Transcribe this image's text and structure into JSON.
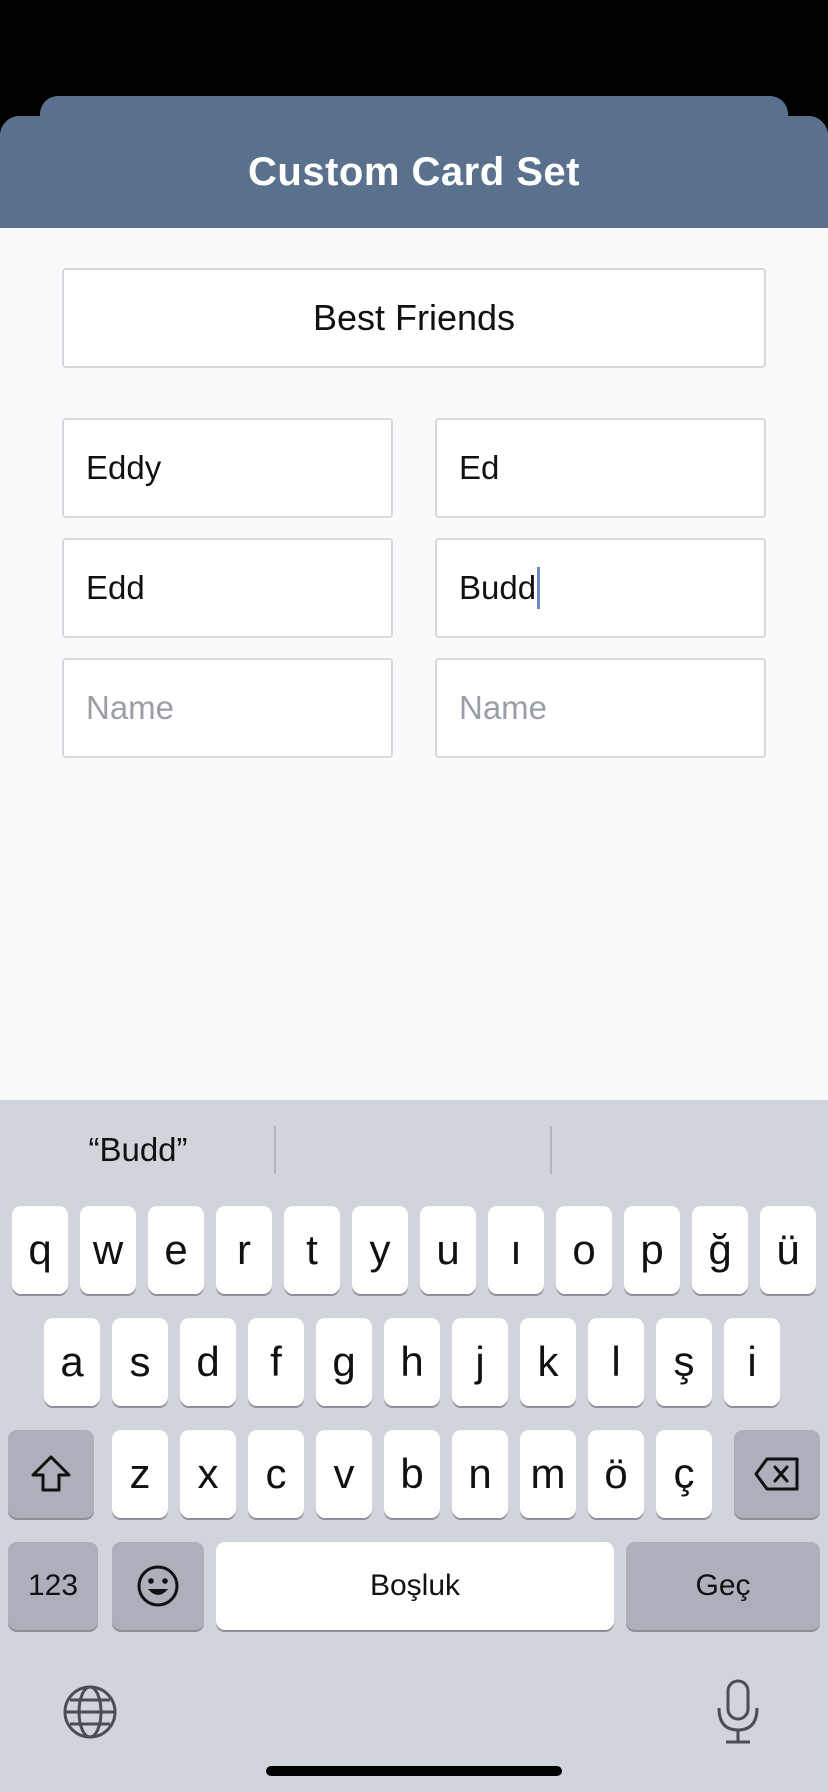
{
  "header": {
    "title": "Custom Card Set"
  },
  "form": {
    "set_name": "Best Friends",
    "names": [
      {
        "value": "Eddy",
        "placeholder": "Name"
      },
      {
        "value": "Ed",
        "placeholder": "Name"
      },
      {
        "value": "Edd",
        "placeholder": "Name"
      },
      {
        "value": "Budd",
        "placeholder": "Name"
      },
      {
        "value": "",
        "placeholder": "Name"
      },
      {
        "value": "",
        "placeholder": "Name"
      }
    ]
  },
  "keyboard": {
    "suggestions": [
      "“Budd”",
      "",
      ""
    ],
    "row1": [
      "q",
      "w",
      "e",
      "r",
      "t",
      "y",
      "u",
      "ı",
      "o",
      "p",
      "ğ",
      "ü"
    ],
    "row2": [
      "a",
      "s",
      "d",
      "f",
      "g",
      "h",
      "j",
      "k",
      "l",
      "ş",
      "i"
    ],
    "row3": [
      "z",
      "x",
      "c",
      "v",
      "b",
      "n",
      "m",
      "ö",
      "ç"
    ],
    "numbers_label": "123",
    "space_label": "Boşluk",
    "return_label": "Geç",
    "icons": {
      "shift": "shift-icon",
      "delete": "delete-icon",
      "emoji": "emoji-icon",
      "globe": "globe-icon",
      "mic": "microphone-icon"
    }
  },
  "colors": {
    "header": "#59718c",
    "caret": "#6e88c9",
    "keyboard_bg": "#d1d4db"
  }
}
